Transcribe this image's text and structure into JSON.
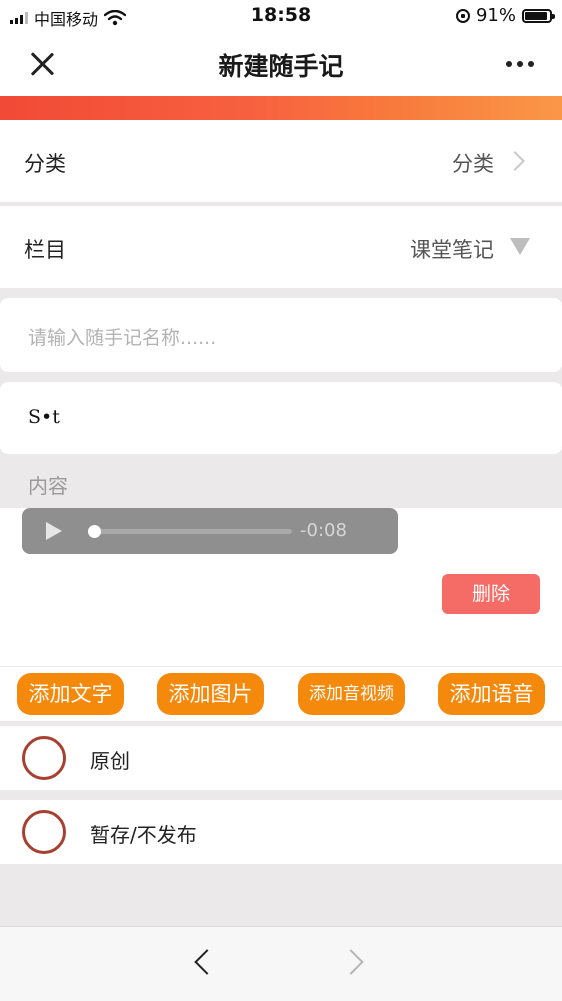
{
  "status_bar": {
    "carrier": "中国移动",
    "time": "18:58",
    "battery": "91%",
    "battery_level": 0.91,
    "icons": [
      "signal-icon",
      "wifi-icon",
      "orientation-lock-icon",
      "battery-icon"
    ]
  },
  "nav": {
    "title": "新建随手记",
    "close_icon": "close-icon",
    "more_icon": "more-icon"
  },
  "category": {
    "label": "分类",
    "value": "分类"
  },
  "column": {
    "label": "栏目",
    "value": "课堂笔记"
  },
  "name_input": {
    "placeholder": "请输入随手记名称......",
    "value": ""
  },
  "content": {
    "text": "S•t",
    "label": "内容"
  },
  "audio_player": {
    "time_remaining": "-0:08",
    "progress": 0
  },
  "delete_label": "删除",
  "add_buttons": [
    {
      "label": "添加文字"
    },
    {
      "label": "添加图片"
    },
    {
      "label": "添加音视频"
    },
    {
      "label": "添加语音"
    }
  ],
  "options": [
    {
      "label": "原创",
      "checked": false
    },
    {
      "label": "暂存/不发布",
      "checked": false
    }
  ],
  "colors": {
    "accent_orange": "#f5890c",
    "delete_red": "#f56b66",
    "radio_ring": "#a8402f",
    "banner_start": "#f14a36",
    "banner_end": "#fa9747"
  }
}
